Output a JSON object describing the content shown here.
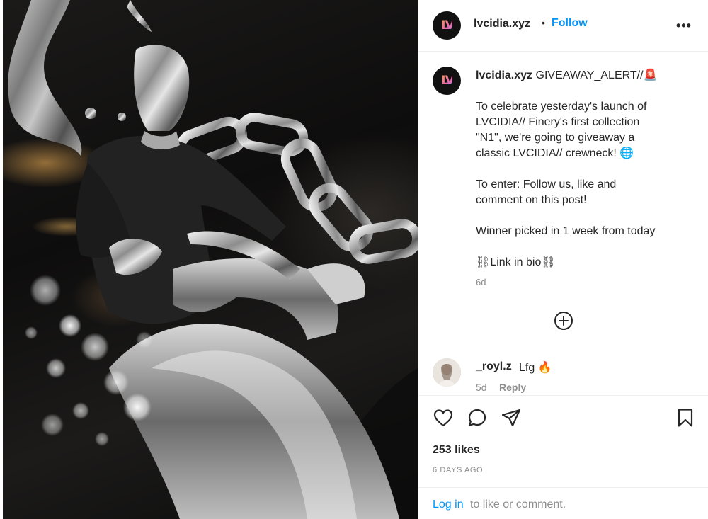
{
  "post": {
    "username": "lvcidia.xyz",
    "avatar_text": "LV",
    "separator": "•",
    "follow_label": "Follow",
    "more_label": "•••"
  },
  "caption": {
    "username": "lvcidia.xyz",
    "first_line": "GIVEAWAY_ALERT//🚨",
    "lines_1": [
      "To celebrate yesterday's launch of",
      "LVCIDIA// Finery's first collection",
      "\"N1\", we're going to giveaway a",
      "classic LVCIDIA// crewneck! 🌐"
    ],
    "lines_2": [
      "To enter: Follow us, like and",
      "comment on this post!"
    ],
    "line_3": "Winner picked in 1 week from today",
    "line_4": "⛓Link in bio⛓",
    "time": "6d"
  },
  "comment": {
    "username": "_royl.z",
    "text": "Lfg 🔥",
    "time": "5d",
    "reply_label": "Reply"
  },
  "actions": {
    "icons": [
      "heart-icon",
      "comment-icon",
      "share-icon",
      "bookmark-icon"
    ],
    "likes": "253 likes",
    "posted_ago": "6 DAYS AGO"
  },
  "login": {
    "link": "Log in",
    "rest": "to like or comment."
  },
  "colors": {
    "accent_blue": "#0095f6",
    "text": "#262626",
    "muted": "#8e8e8e",
    "border": "#efefef"
  }
}
